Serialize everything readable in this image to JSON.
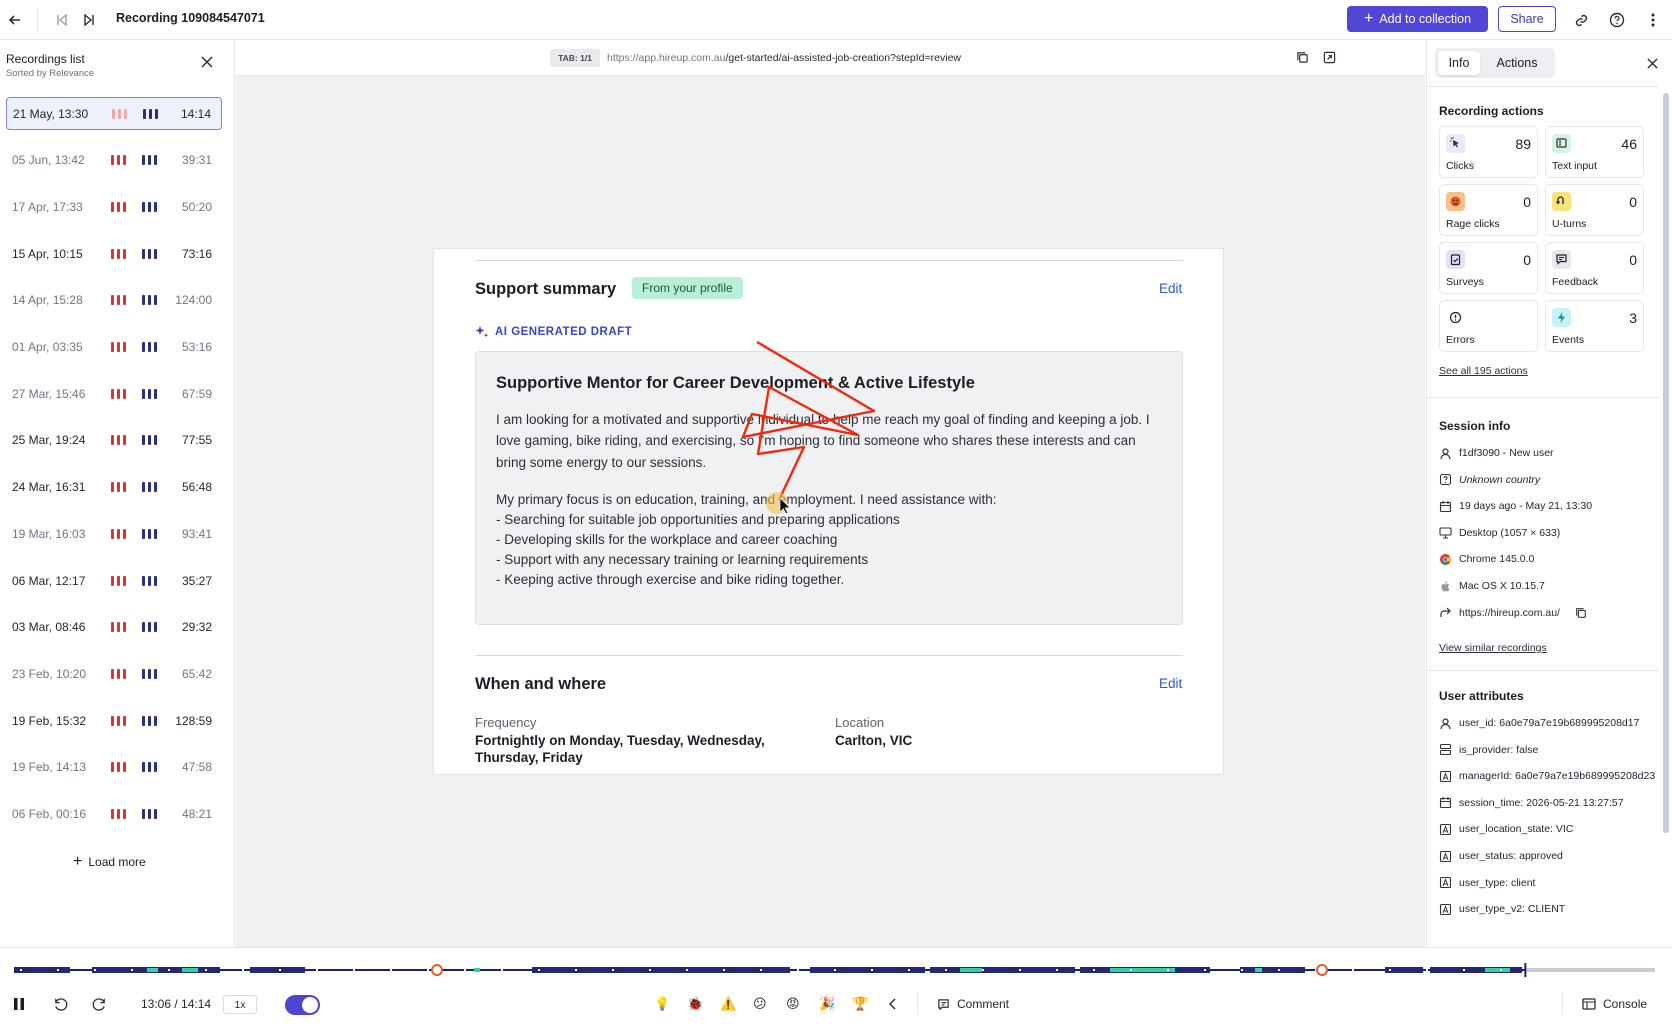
{
  "header": {
    "recording_title": "Recording 109084547071",
    "add_to_collection": "Add to collection",
    "share": "Share"
  },
  "recordings_list": {
    "title": "Recordings list",
    "subtitle": "Sorted by Relevance",
    "items": [
      {
        "date": "21 May, 13:30",
        "duration": "14:14"
      },
      {
        "date": "05 Jun, 13:42",
        "duration": "39:31"
      },
      {
        "date": "17 Apr, 17:33",
        "duration": "50:20"
      },
      {
        "date": "15 Apr, 10:15",
        "duration": "73:16"
      },
      {
        "date": "14 Apr, 15:28",
        "duration": "124:00"
      },
      {
        "date": "01 Apr, 03:35",
        "duration": "53:16"
      },
      {
        "date": "27 Mar, 15:46",
        "duration": "67:59"
      },
      {
        "date": "25 Mar, 19:24",
        "duration": "77:55"
      },
      {
        "date": "24 Mar, 16:31",
        "duration": "56:48"
      },
      {
        "date": "19 Mar, 16:03",
        "duration": "93:41"
      },
      {
        "date": "06 Mar, 12:17",
        "duration": "35:27"
      },
      {
        "date": "03 Mar, 08:46",
        "duration": "29:32"
      },
      {
        "date": "23 Feb, 10:20",
        "duration": "65:42"
      },
      {
        "date": "19 Feb, 15:32",
        "duration": "128:59"
      },
      {
        "date": "19 Feb, 14:13",
        "duration": "47:58"
      },
      {
        "date": "06 Feb, 00:16",
        "duration": "48:21"
      }
    ],
    "load_more": "Load more"
  },
  "viewer": {
    "tab_label": "TAB: 1/1",
    "url_host": "https://app.hireup.com.au",
    "url_path": "/get-started/ai-assisted-job-creation?stepId=review"
  },
  "page": {
    "support_summary": "Support summary",
    "profile_chip": "From your profile",
    "edit": "Edit",
    "ai_draft": "AI GENERATED DRAFT",
    "draft_title": "Supportive Mentor for Career Development & Active Lifestyle",
    "draft_p1": "I am looking for a motivated and supportive individual to help me reach my goal of finding and keeping a job. I love gaming, bike riding, and exercising, so I'm hoping to find someone who shares these interests and can bring some energy to our sessions.",
    "draft_p2": "My primary focus is on education, training, and employment. I need assistance with:",
    "draft_list": [
      "- Searching for suitable job opportunities and preparing applications",
      "- Developing skills for the workplace and career coaching",
      "- Support with any necessary training or learning requirements",
      "- Keeping active through exercise and bike riding together."
    ],
    "when_where": "When and where",
    "frequency_label": "Frequency",
    "frequency_value": "Fortnightly on Monday, Tuesday, Wednesday, Thursday, Friday",
    "location_label": "Location",
    "location_value": "Carlton, VIC"
  },
  "right_panel": {
    "tab_info": "Info",
    "tab_actions": "Actions",
    "recording_actions_title": "Recording actions",
    "actions": [
      {
        "label": "Clicks",
        "count": "89",
        "icon": "cursor-click-icon",
        "color": "#e8ebf5"
      },
      {
        "label": "Text input",
        "count": "46",
        "icon": "text-input-icon",
        "color": "#d4f3e4"
      },
      {
        "label": "Rage clicks",
        "count": "0",
        "icon": "rage-face-icon",
        "color": "#f7c28a"
      },
      {
        "label": "U-turns",
        "count": "0",
        "icon": "u-turn-icon",
        "color": "#f8e27a"
      },
      {
        "label": "Surveys",
        "count": "0",
        "icon": "clipboard-icon",
        "color": "#dfe2f6"
      },
      {
        "label": "Feedback",
        "count": "0",
        "icon": "chat-icon",
        "color": "#e6e8ee"
      },
      {
        "label": "Errors",
        "count": "",
        "icon": "error-icon",
        "color": "#ffffff"
      },
      {
        "label": "Events",
        "count": "3",
        "icon": "bolt-icon",
        "color": "#c9f2f4"
      }
    ],
    "see_all": "See all 195 actions",
    "session_info_title": "Session info",
    "session_info": [
      {
        "icon": "user-icon",
        "text": "f1df3090 - New user"
      },
      {
        "icon": "question-icon",
        "text": "Unknown country"
      },
      {
        "icon": "calendar-icon",
        "text": "19 days ago - May 21, 13:30"
      },
      {
        "icon": "desktop-icon",
        "text": "Desktop (1057 × 633)"
      },
      {
        "icon": "chrome-icon",
        "text": "Chrome 145.0.0"
      },
      {
        "icon": "apple-icon",
        "text": "Mac OS X 10.15.7"
      },
      {
        "icon": "share-arrow-icon",
        "text": "https://hireup.com.au/"
      }
    ],
    "view_similar": "View similar recordings",
    "user_attributes_title": "User attributes",
    "user_attributes": [
      {
        "icon": "user-icon",
        "text": "user_id: 6a0e79a7e19b689995208d17"
      },
      {
        "icon": "database-icon",
        "text": "is_provider: false"
      },
      {
        "icon": "text-attr-icon",
        "text": "managerId: 6a0e79a7e19b689995208d23"
      },
      {
        "icon": "calendar-icon",
        "text": "session_time: 2026-05-21 13:27:57"
      },
      {
        "icon": "text-attr-icon",
        "text": "user_location_state: VIC"
      },
      {
        "icon": "text-attr-icon",
        "text": "user_status: approved"
      },
      {
        "icon": "text-attr-icon",
        "text": "user_type: client"
      },
      {
        "icon": "text-attr-icon",
        "text": "user_type_v2: CLIENT"
      }
    ]
  },
  "player": {
    "time": "13:06 / 14:14",
    "speed": "1x",
    "progress": 0.921,
    "comment": "Comment",
    "console": "Console"
  }
}
